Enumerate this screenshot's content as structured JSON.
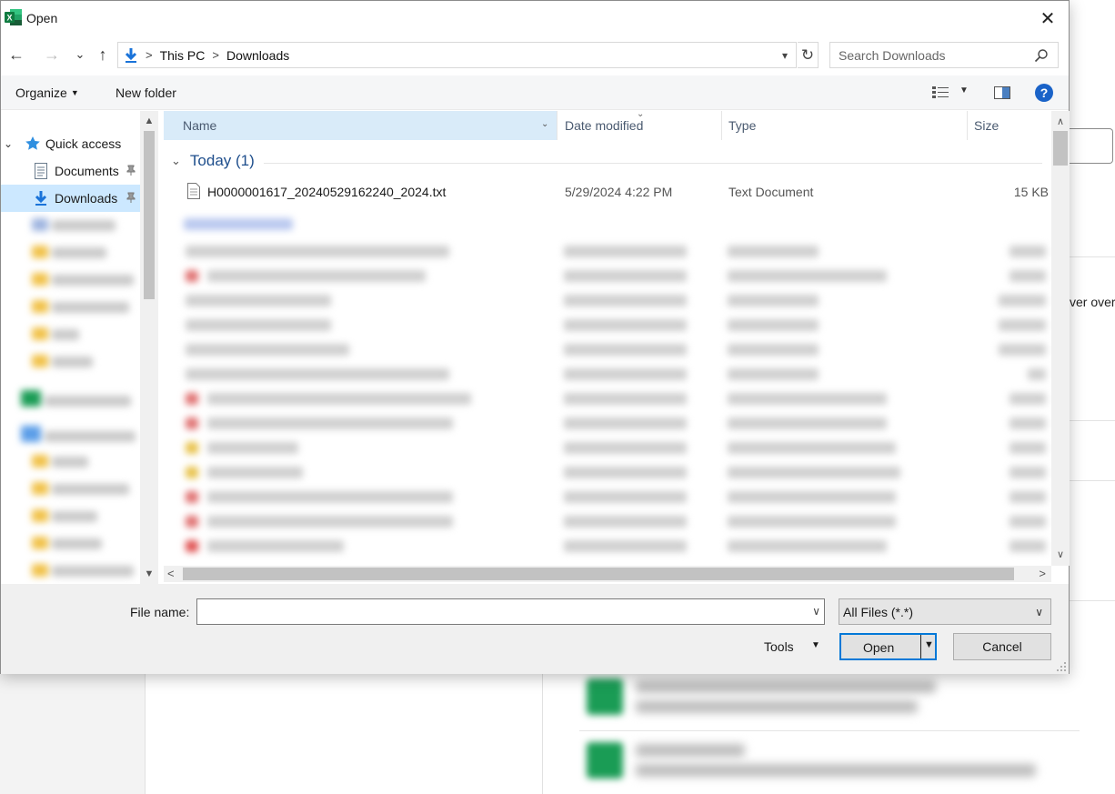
{
  "window": {
    "title": "Open",
    "app_icon": "excel-icon",
    "close_glyph": "✕"
  },
  "nav": {
    "back_glyph": "←",
    "forward_glyph": "→",
    "recent_glyph": "⌄",
    "up_glyph": "↑",
    "breadcrumb": [
      "This PC",
      "Downloads"
    ],
    "refresh_glyph": "↻",
    "search_placeholder": "Search Downloads"
  },
  "toolbar": {
    "organize_label": "Organize",
    "new_folder_label": "New folder",
    "help_glyph": "?"
  },
  "sidebar": {
    "quick_access_label": "Quick access",
    "items": [
      {
        "label": "Documents",
        "pinned": true
      },
      {
        "label": "Downloads",
        "pinned": true,
        "selected": true
      }
    ]
  },
  "file_list": {
    "columns": [
      "Name",
      "Date modified",
      "Type",
      "Size"
    ],
    "group_label": "Today (1)",
    "files": [
      {
        "name": "H0000001617_20240529162240_2024.txt",
        "date_modified": "5/29/2024 4:22 PM",
        "type": "Text Document",
        "size": "15 KB"
      }
    ]
  },
  "footer": {
    "file_name_label": "File name:",
    "file_name_value": "",
    "file_type_selected": "All Files (*.*)",
    "tools_label": "Tools",
    "open_label": "Open",
    "cancel_label": "Cancel"
  },
  "background": {
    "partial_text": "ver over"
  },
  "colors": {
    "accent": "#0078d7",
    "selection": "#cce8ff",
    "header_selected": "#d9ebf9",
    "group_text": "#1e4e8c",
    "excel_green": "#1d6f42"
  }
}
